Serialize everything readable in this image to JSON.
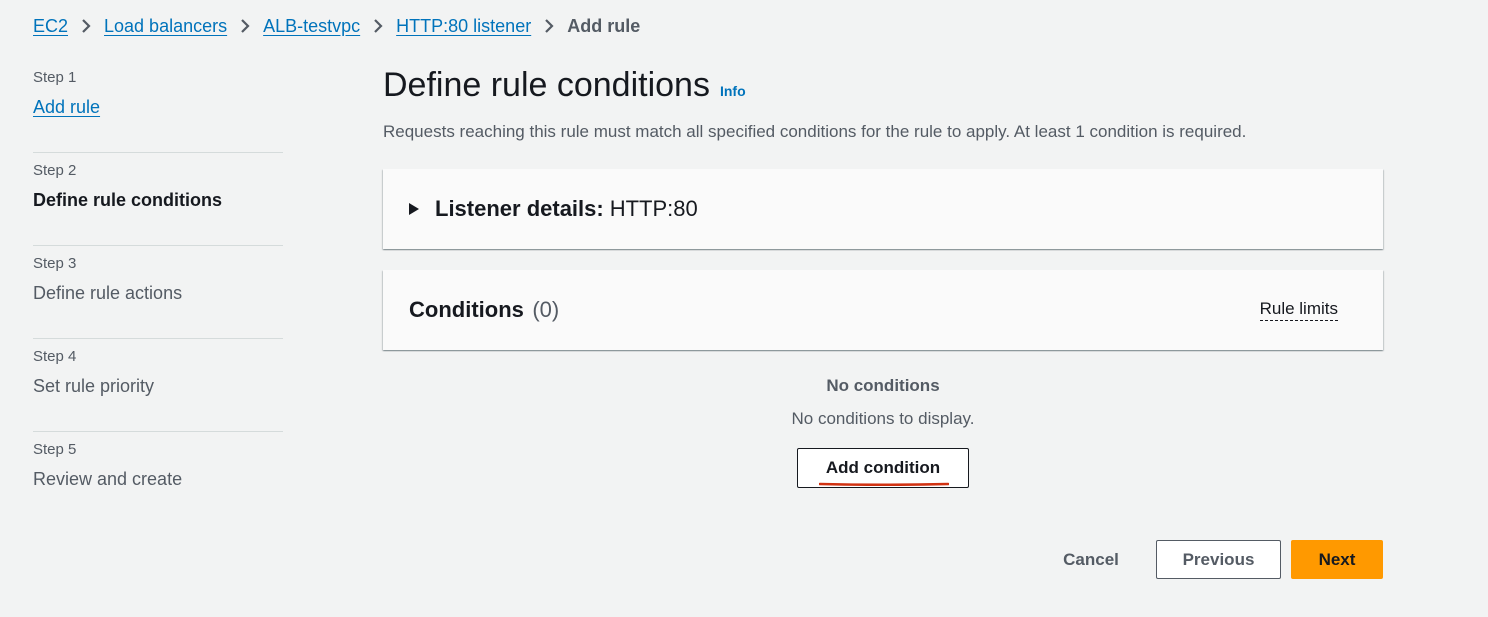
{
  "breadcrumb": {
    "items": [
      "EC2",
      "Load balancers",
      "ALB-testvpc",
      "HTTP:80 listener"
    ],
    "current": "Add rule"
  },
  "steps": [
    {
      "num": "Step 1",
      "title": "Add rule",
      "state": "link"
    },
    {
      "num": "Step 2",
      "title": "Define rule conditions",
      "state": "current"
    },
    {
      "num": "Step 3",
      "title": "Define rule actions",
      "state": "disabled"
    },
    {
      "num": "Step 4",
      "title": "Set rule priority",
      "state": "disabled"
    },
    {
      "num": "Step 5",
      "title": "Review and create",
      "state": "disabled"
    }
  ],
  "page": {
    "title": "Define rule conditions",
    "info": "Info",
    "description": "Requests reaching this rule must match all specified conditions for the rule to apply. At least 1 condition is required."
  },
  "listener": {
    "label": "Listener details:",
    "value": "HTTP:80"
  },
  "conditions": {
    "title": "Conditions",
    "count": "(0)",
    "rule_limits": "Rule limits",
    "empty_title": "No conditions",
    "empty_desc": "No conditions to display.",
    "add_button": "Add condition"
  },
  "footer": {
    "cancel": "Cancel",
    "previous": "Previous",
    "next": "Next"
  },
  "colors": {
    "link": "#0073bb",
    "primary_button": "#ff9900",
    "annotation_underline": "#d13212"
  }
}
